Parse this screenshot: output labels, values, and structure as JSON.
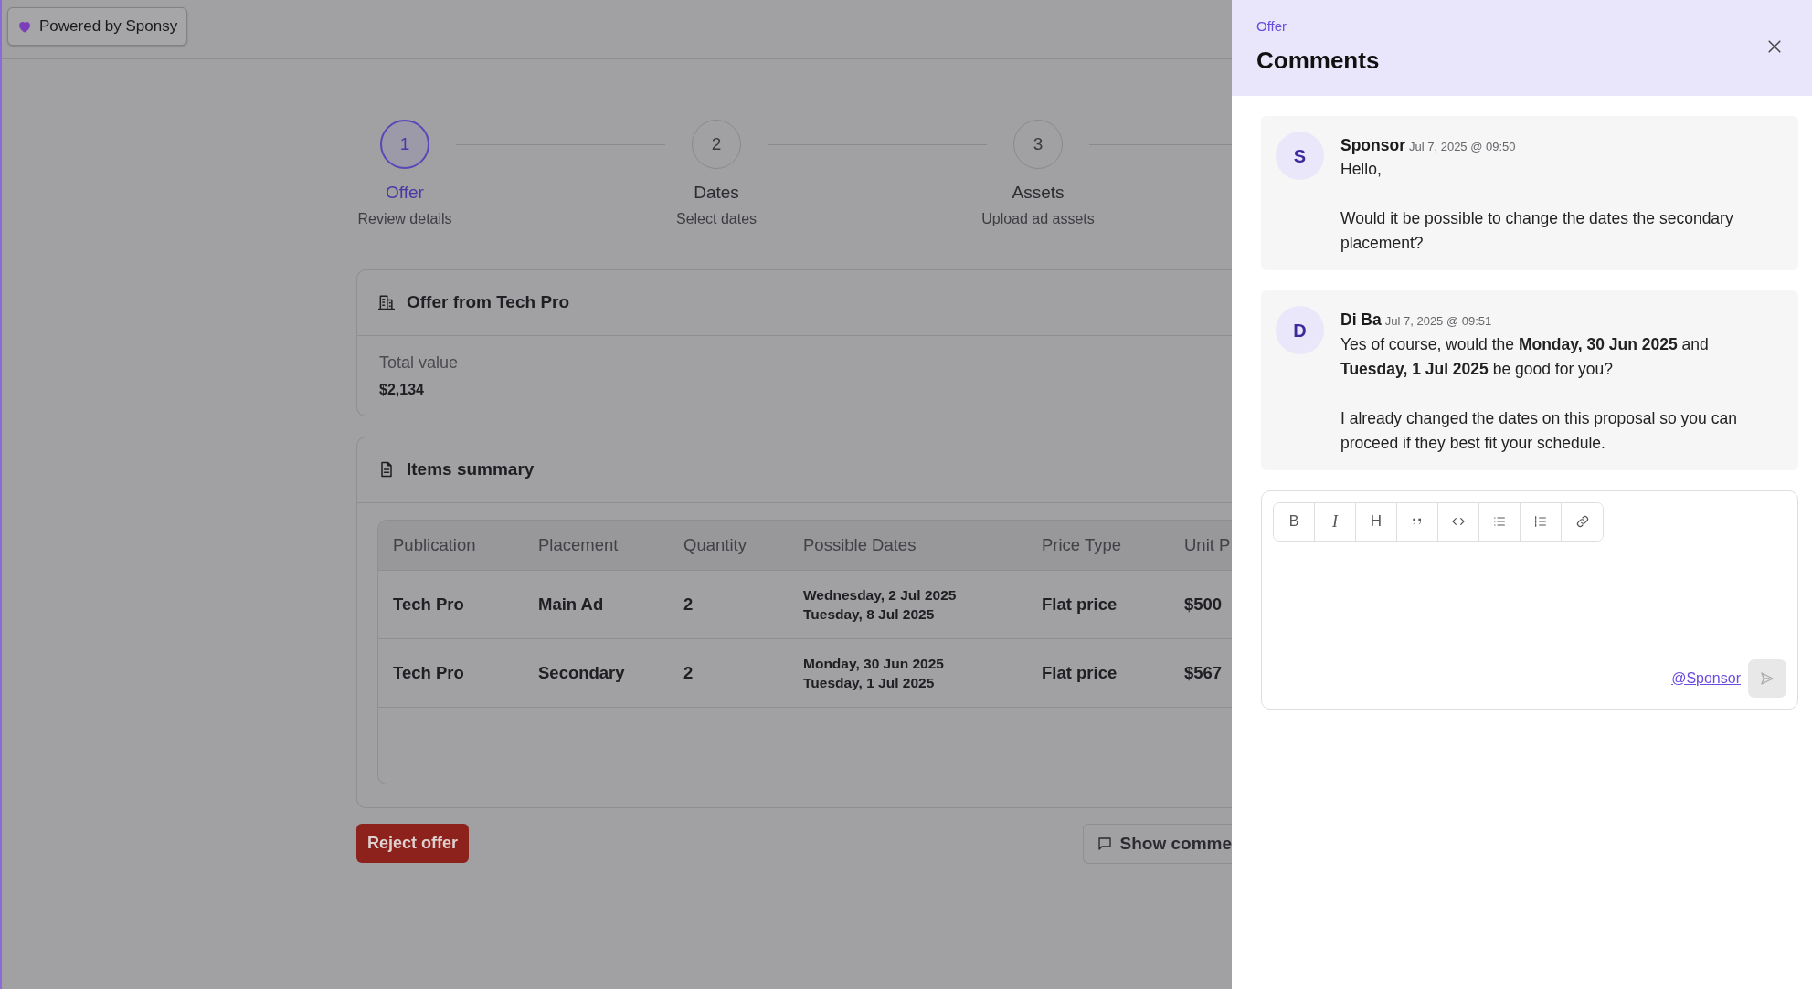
{
  "badge": {
    "label": "Powered by Sponsy"
  },
  "steps": [
    {
      "number": "1",
      "title": "Offer",
      "subtitle": "Review details",
      "selected": true
    },
    {
      "number": "2",
      "title": "Dates",
      "subtitle": "Select dates",
      "selected": false
    },
    {
      "number": "3",
      "title": "Assets",
      "subtitle": "Upload ad assets",
      "selected": false
    }
  ],
  "offer_card": {
    "title": "Offer from Tech Pro",
    "total_label": "Total value",
    "total_value": "$2,134"
  },
  "items_card": {
    "title": "Items summary",
    "table": {
      "columns": [
        "Publication",
        "Placement",
        "Quantity",
        "Possible Dates",
        "Price Type",
        "Unit P"
      ],
      "rows": [
        {
          "publication": "Tech Pro",
          "placement": "Main Ad",
          "quantity": "2",
          "dates": [
            "Wednesday, 2 Jul 2025",
            "Tuesday, 8 Jul 2025"
          ],
          "price_type": "Flat price",
          "unit_price": "$500"
        },
        {
          "publication": "Tech Pro",
          "placement": "Secondary",
          "quantity": "2",
          "dates": [
            "Monday, 30 Jun 2025",
            "Tuesday, 1 Jul 2025"
          ],
          "price_type": "Flat price",
          "unit_price": "$567"
        }
      ]
    }
  },
  "actions": {
    "reject": "Reject offer",
    "show_comments": "Show comme"
  },
  "panel": {
    "eyebrow": "Offer",
    "title": "Comments",
    "comments": [
      {
        "initial": "S",
        "author": "Sponsor",
        "time": "Jul 7, 2025 @ 09:50",
        "paragraphs": [
          "Hello,",
          "Would it be possible to change the dates the secondary placement?"
        ]
      },
      {
        "initial": "D",
        "author": "Di Ba",
        "time": "Jul 7, 2025 @ 09:51",
        "paragraphs": [
          "Yes of course, would the **Monday, 30 Jun 2025** and **Tuesday, 1 Jul 2025** be good for you?",
          "I already changed the dates on this proposal so you can proceed if they best fit your schedule."
        ]
      }
    ],
    "editor": {
      "toolbar": [
        {
          "kind": "bold",
          "label": "B"
        },
        {
          "kind": "italic",
          "label": "I"
        },
        {
          "kind": "heading",
          "label": "H"
        },
        {
          "kind": "quote"
        },
        {
          "kind": "code"
        },
        {
          "kind": "bullet-list"
        },
        {
          "kind": "ordered-list"
        },
        {
          "kind": "link"
        }
      ],
      "mention": "@Sponsor"
    }
  }
}
